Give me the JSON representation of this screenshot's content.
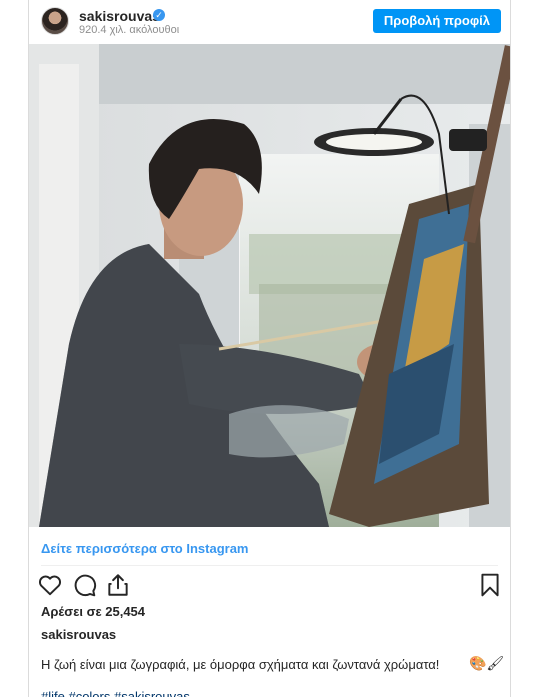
{
  "header": {
    "username": "sakisrouvas",
    "followers": "920.4 χιλ. ακόλουθοι",
    "profile_button": "Προβολή προφίλ"
  },
  "post": {
    "more_link": "Δείτε περισσότερα στο Instagram",
    "likes": "Αρέσει σε 25,454",
    "author": "sakisrouvas",
    "caption": "Η ζωή είναι μια ζωγραφιά, με όμορφα σχήματα και ζωντανά χρώματα!",
    "caption_emoji": "🎨🖌",
    "hashtags": "#life #colors #sakisrouvas"
  },
  "icons": [
    "verified-icon",
    "heart-icon",
    "comment-icon",
    "share-icon",
    "bookmark-icon"
  ],
  "colors": {
    "accent": "#0095f6",
    "link": "#3897f0",
    "hashtag": "#003569",
    "text": "#262626",
    "muted": "#8e8e8e"
  }
}
